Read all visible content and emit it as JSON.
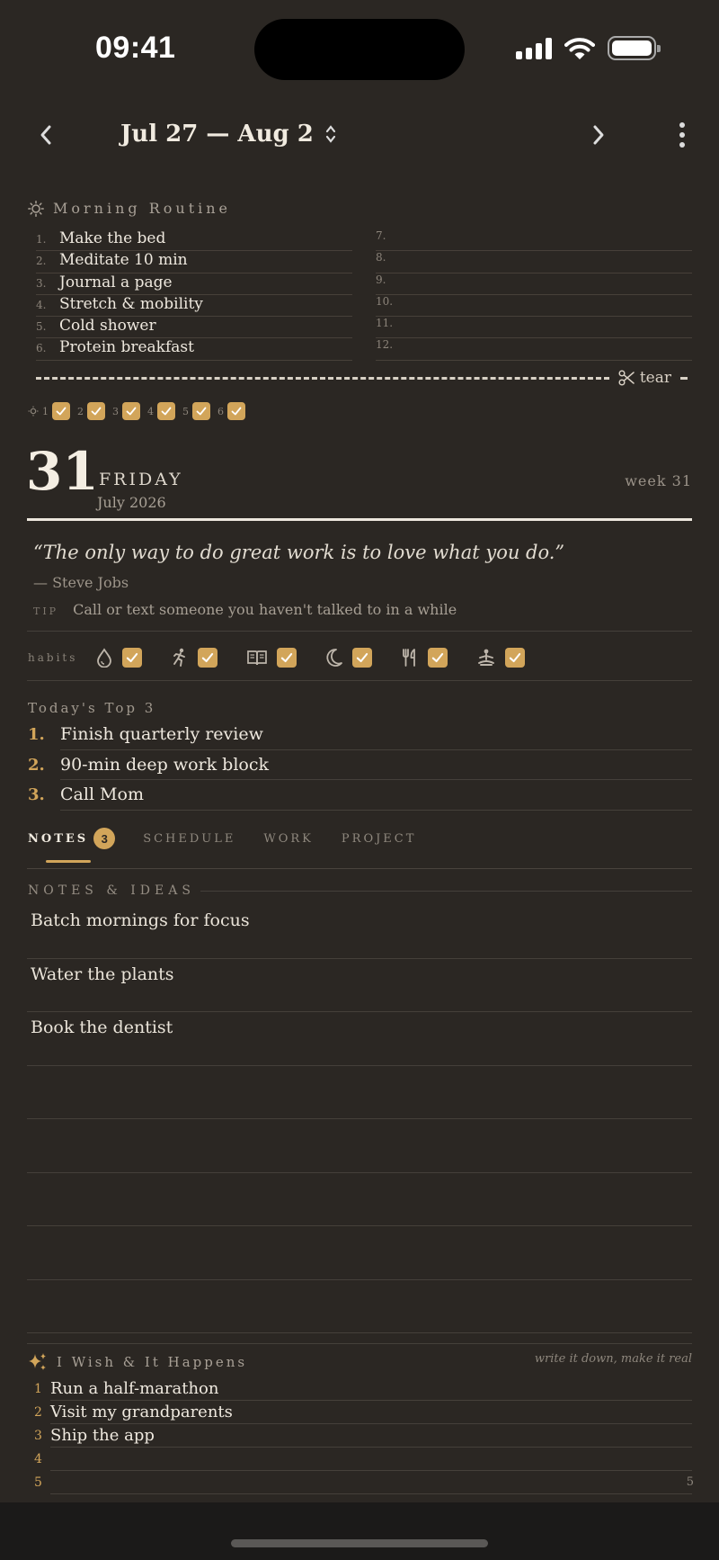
{
  "status_bar": {
    "time": "09:41"
  },
  "header": {
    "date_range": "Jul 27 — Aug 2"
  },
  "morning_routine": {
    "title": "Morning Routine",
    "items": [
      {
        "num": "1.",
        "text": "Make the bed"
      },
      {
        "num": "2.",
        "text": "Meditate 10 min"
      },
      {
        "num": "3.",
        "text": "Journal a page"
      },
      {
        "num": "4.",
        "text": "Stretch & mobility"
      },
      {
        "num": "5.",
        "text": "Cold shower"
      },
      {
        "num": "6.",
        "text": "Protein breakfast"
      },
      {
        "num": "7.",
        "text": ""
      },
      {
        "num": "8.",
        "text": ""
      },
      {
        "num": "9.",
        "text": ""
      },
      {
        "num": "10.",
        "text": ""
      },
      {
        "num": "11.",
        "text": ""
      },
      {
        "num": "12.",
        "text": ""
      }
    ],
    "tear_label": "tear",
    "checks": [
      "1",
      "2",
      "3",
      "4",
      "5",
      "6"
    ]
  },
  "day": {
    "number": "31",
    "weekday": "FRIDAY",
    "month_year": "July 2026",
    "week": "week 31"
  },
  "quote": {
    "text": "“The only way to do great work is to love what you do.”",
    "author": "— Steve Jobs"
  },
  "tip": {
    "label": "TIP",
    "text": "Call or text someone you haven't talked to in a while"
  },
  "habits": {
    "label": "habits",
    "items": [
      {
        "icon": "water-drop-icon",
        "checked": true
      },
      {
        "icon": "running-icon",
        "checked": true
      },
      {
        "icon": "book-icon",
        "checked": true
      },
      {
        "icon": "moon-icon",
        "checked": true
      },
      {
        "icon": "fork-knife-icon",
        "checked": true
      },
      {
        "icon": "meditation-icon",
        "checked": true
      }
    ]
  },
  "top3": {
    "title": "Today's Top 3",
    "items": [
      {
        "num": "1.",
        "text": "Finish quarterly review"
      },
      {
        "num": "2.",
        "text": "90-min deep work block"
      },
      {
        "num": "3.",
        "text": "Call Mom"
      }
    ]
  },
  "tabs": [
    {
      "label": "NOTES",
      "badge": "3",
      "active": true
    },
    {
      "label": "SCHEDULE"
    },
    {
      "label": "WORK"
    },
    {
      "label": "PROJECT"
    }
  ],
  "notes": {
    "title": "NOTES & IDEAS",
    "items": [
      "Batch mornings for focus",
      "Water the plants",
      "Book the dentist",
      "",
      "",
      "",
      "",
      ""
    ]
  },
  "wish": {
    "title": "I Wish & It Happens",
    "subtitle": "write it down, make it real",
    "items": [
      {
        "num": "1",
        "text": "Run a half-marathon"
      },
      {
        "num": "2",
        "text": "Visit my grandparents"
      },
      {
        "num": "3",
        "text": "Ship the app"
      },
      {
        "num": "4",
        "text": ""
      },
      {
        "num": "5",
        "text": ""
      }
    ]
  },
  "page_number": "5",
  "colors": {
    "background": "#2b2723",
    "accent": "#d2a55a",
    "text": "#ece6dc"
  }
}
